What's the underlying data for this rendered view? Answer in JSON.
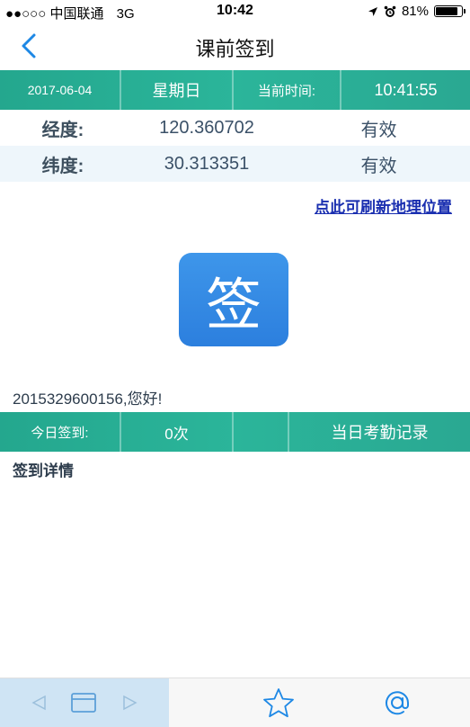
{
  "status_bar": {
    "carrier": "●●○○○ 中国联通",
    "network": "3G",
    "time": "10:42",
    "battery": "81%",
    "battery_level": 0.81
  },
  "nav": {
    "title": "课前签到",
    "back_icon": "chevron-left-icon"
  },
  "info_bar": {
    "date": "2017-06-04",
    "weekday": "星期日",
    "time_label": "当前时间:",
    "time_value": "10:41:55"
  },
  "location": {
    "longitude_label": "经度:",
    "longitude_value": "120.360702",
    "longitude_status": "有效",
    "latitude_label": "纬度:",
    "latitude_value": "30.313351",
    "latitude_status": "有效"
  },
  "refresh_link": "点此可刷新地理位置",
  "sign_button": "签",
  "greeting": "2015329600156,您好!",
  "today_bar": {
    "label": "今日签到:",
    "count": "0次",
    "records": "当日考勤记录"
  },
  "detail_label": "签到详情",
  "colors": {
    "teal": "#2bb59a",
    "row_highlight": "#eef6fb",
    "button_blue": "#2c7fde",
    "link": "#1a2fb0",
    "ios_blue": "#1e88e5"
  }
}
